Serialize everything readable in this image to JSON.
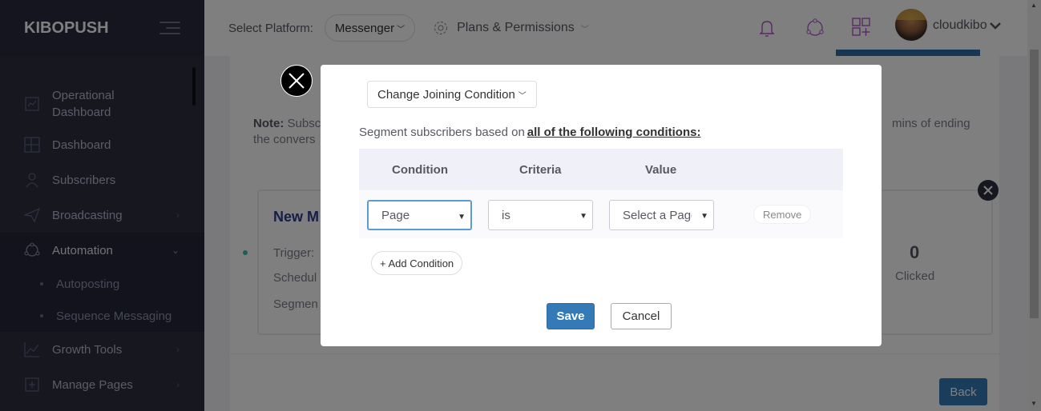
{
  "brand": "KIBOPUSH",
  "sidebar": {
    "items": [
      {
        "label": "Operational Dashboard",
        "line1": "Operational",
        "line2": "Dashboard",
        "icon": "chart-board-icon"
      },
      {
        "label": "Dashboard",
        "icon": "grid-icon"
      },
      {
        "label": "Subscribers",
        "icon": "user-icon"
      },
      {
        "label": "Broadcasting",
        "icon": "paper-plane-icon",
        "chevron": "›"
      },
      {
        "label": "Automation",
        "icon": "network-icon",
        "chevron": "⌄"
      },
      {
        "label": "Growth Tools",
        "icon": "line-chart-icon",
        "chevron": "›"
      },
      {
        "label": "Manage Pages",
        "icon": "add-page-icon",
        "chevron": "›"
      }
    ],
    "subitems": [
      "Autoposting",
      "Sequence Messaging"
    ]
  },
  "topbar": {
    "platform_label": "Select Platform:",
    "platform_value": "Messenger",
    "plans_label": "Plans & Permissions",
    "username": "cloudkibo"
  },
  "background": {
    "note_label": "Note:",
    "note_text": "Subsc",
    "note_text2": "the convers",
    "note_right": "mins of ending",
    "card_title": "New M",
    "trigger": "Trigger:",
    "schedule": "Schedul",
    "segment": "Segmen",
    "clicked_value": "0",
    "clicked_label": "Clicked",
    "back": "Back"
  },
  "modal": {
    "joining_condition": "Change Joining Condition",
    "segment_text": "Segment subscribers based on",
    "segment_bold": "all of the following conditions:",
    "headers": [
      "Condition",
      "Criteria",
      "Value"
    ],
    "row": {
      "condition": "Page",
      "criteria": "is",
      "value": "Select a Page",
      "remove": "Remove"
    },
    "add_condition": "+ Add Condition",
    "save": "Save",
    "cancel": "Cancel"
  },
  "colors": {
    "primary": "#337ab7",
    "sidebar": "#2c2e3e",
    "accent": "#716aca"
  }
}
